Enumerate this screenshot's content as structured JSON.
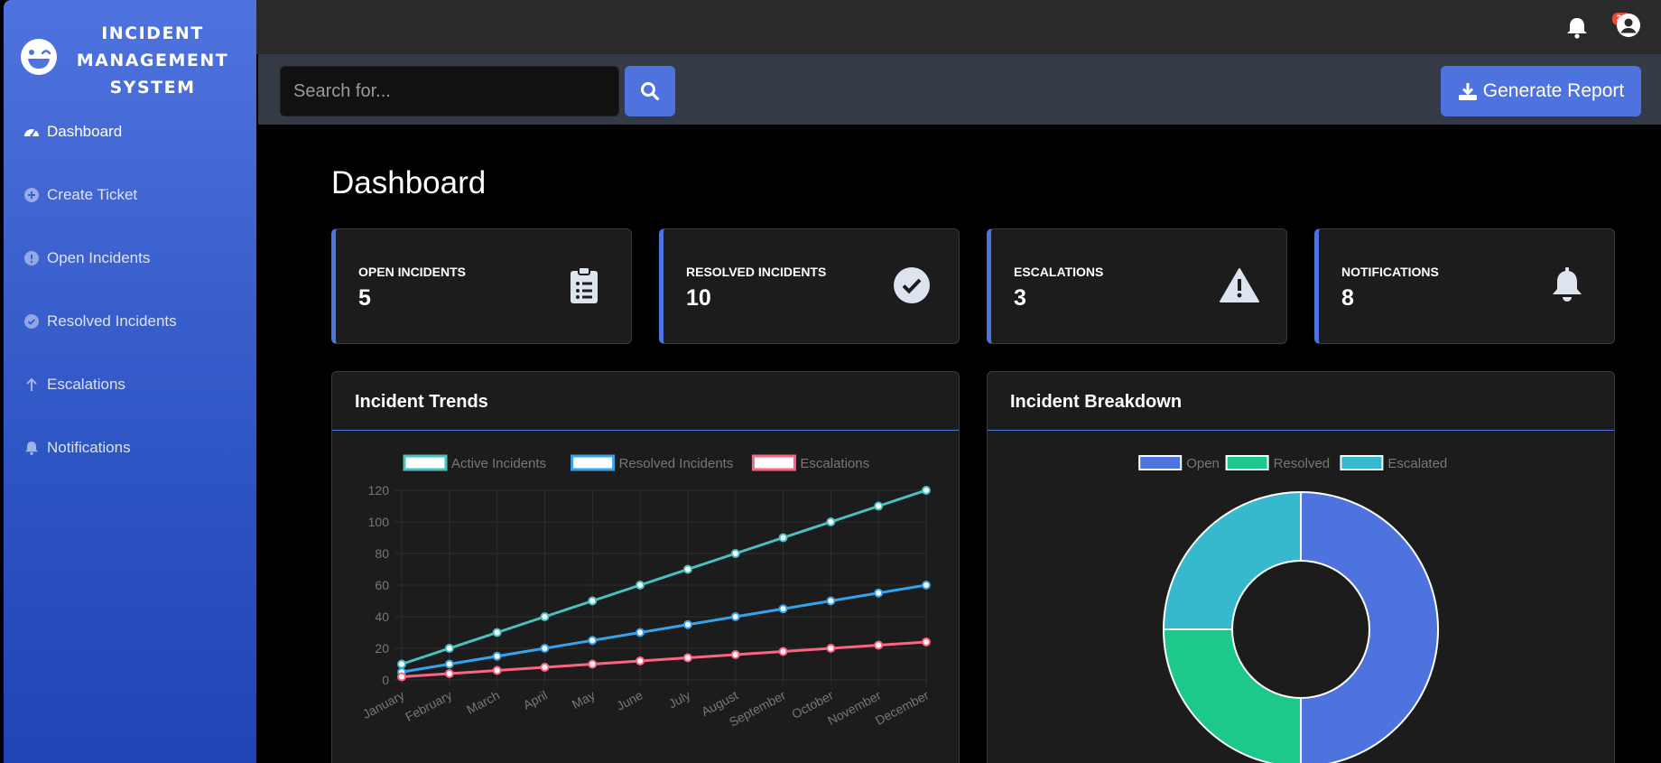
{
  "brand": {
    "title_lines": [
      "INCIDENT",
      "MANAGEMENT",
      "SYSTEM"
    ]
  },
  "sidebar": {
    "items": [
      {
        "label": "Dashboard",
        "icon": "gauge-icon"
      },
      {
        "label": "Create Ticket",
        "icon": "plus-circle-icon"
      },
      {
        "label": "Open Incidents",
        "icon": "info-circle-icon"
      },
      {
        "label": "Resolved Incidents",
        "icon": "check-circle-icon"
      },
      {
        "label": "Escalations",
        "icon": "arrow-up-icon"
      },
      {
        "label": "Notifications",
        "icon": "bell-icon"
      }
    ]
  },
  "topbar": {
    "badge": "3+",
    "icons": [
      "bell-icon",
      "user-circle-icon"
    ]
  },
  "toolbar": {
    "search_placeholder": "Search for...",
    "report_label": "Generate Report"
  },
  "page": {
    "title": "Dashboard"
  },
  "cards": [
    {
      "label": "OPEN INCIDENTS",
      "value": "5",
      "icon": "clipboard-list-icon"
    },
    {
      "label": "RESOLVED INCIDENTS",
      "value": "10",
      "icon": "check-circle-icon"
    },
    {
      "label": "ESCALATIONS",
      "value": "3",
      "icon": "warning-triangle-icon"
    },
    {
      "label": "NOTIFICATIONS",
      "value": "8",
      "icon": "bell-icon"
    }
  ],
  "panels": {
    "trends_title": "Incident Trends",
    "breakdown_title": "Incident Breakdown"
  },
  "colors": {
    "accent": "#4e73df",
    "active": "#4bc0c0",
    "resolved": "#36a2eb",
    "escalations": "#ff6384",
    "open_slice": "#4e73df",
    "resolved_slice": "#1cc88a",
    "escalated_slice": "#36b9cc"
  },
  "chart_data": [
    {
      "type": "line",
      "categories": [
        "January",
        "February",
        "March",
        "April",
        "May",
        "June",
        "July",
        "August",
        "September",
        "October",
        "November",
        "December"
      ],
      "series": [
        {
          "name": "Active Incidents",
          "values": [
            10,
            20,
            30,
            40,
            50,
            60,
            70,
            80,
            90,
            100,
            110,
            120
          ]
        },
        {
          "name": "Resolved Incidents",
          "values": [
            5,
            10,
            15,
            20,
            25,
            30,
            35,
            40,
            45,
            50,
            55,
            60
          ]
        },
        {
          "name": "Escalations",
          "values": [
            2,
            4,
            6,
            8,
            10,
            12,
            14,
            16,
            18,
            20,
            22,
            24
          ]
        }
      ],
      "yticks": [
        "0",
        "20",
        "40",
        "60",
        "80",
        100,
        "120"
      ],
      "ylim": [
        0,
        120
      ],
      "grid": true,
      "legend": "top"
    },
    {
      "type": "pie",
      "variant": "doughnut",
      "categories": [
        "Open",
        "Resolved",
        "Escalated"
      ],
      "values": [
        50,
        25,
        25
      ],
      "legend": "top"
    }
  ]
}
